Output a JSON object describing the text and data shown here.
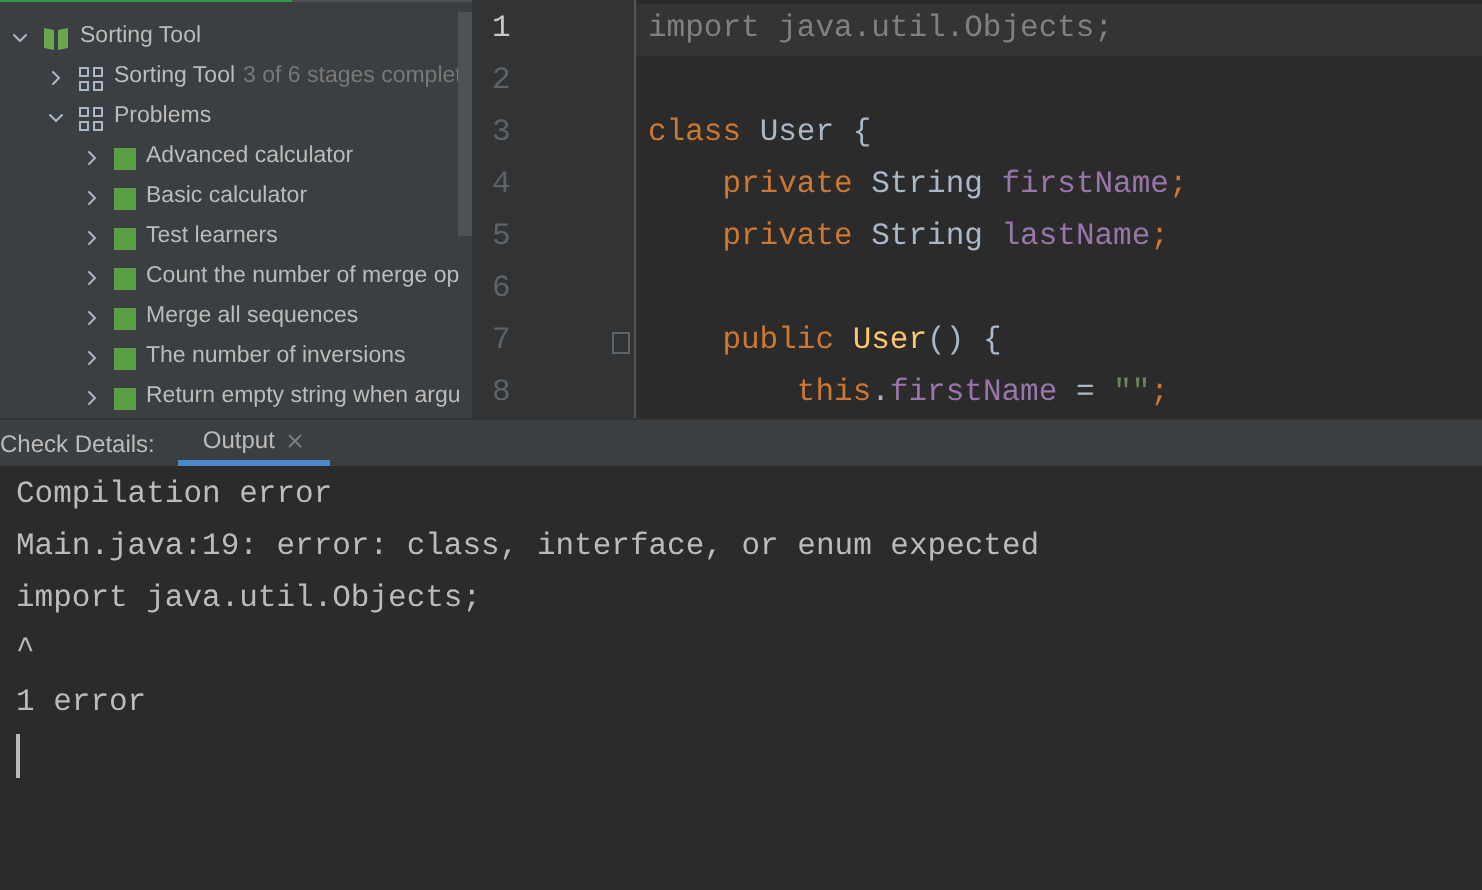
{
  "course_progress": {
    "level": 0.62
  },
  "project_tree": [
    {
      "kind": "course",
      "label": "Sorting Tool",
      "expanded": true,
      "children": [
        {
          "kind": "section",
          "label": "Sorting Tool",
          "note": "3 of 6 stages complet",
          "expanded": false
        },
        {
          "kind": "section",
          "label": "Problems",
          "expanded": true,
          "children": [
            {
              "kind": "task",
              "label": "Advanced calculator",
              "expanded": false
            },
            {
              "kind": "task",
              "label": "Basic calculator",
              "expanded": false
            },
            {
              "kind": "task",
              "label": "Test learners",
              "expanded": false
            },
            {
              "kind": "task",
              "label": "Count the number of merge op",
              "expanded": false
            },
            {
              "kind": "task",
              "label": "Merge all sequences",
              "expanded": false
            },
            {
              "kind": "task",
              "label": "The number of inversions",
              "expanded": false
            },
            {
              "kind": "task",
              "label": "Return empty string when argu",
              "expanded": false
            }
          ]
        }
      ]
    }
  ],
  "editor": {
    "lines": [
      {
        "number": "1",
        "current": true,
        "tokens": [
          {
            "kind": "unused",
            "text": "import java.util.Objects;"
          }
        ]
      },
      {
        "number": "2",
        "current": false
      },
      {
        "number": "3",
        "current": false,
        "tokens": [
          {
            "kind": "keyword",
            "text": "class "
          },
          {
            "kind": "plain",
            "text": "User {"
          }
        ]
      },
      {
        "number": "4",
        "current": false,
        "tokens": [
          {
            "kind": "keyword",
            "text": "    private "
          },
          {
            "kind": "plain",
            "text": "String "
          },
          {
            "kind": "field",
            "text": "firstName"
          },
          {
            "kind": "keyword",
            "text": ";"
          }
        ]
      },
      {
        "number": "5",
        "current": false,
        "tokens": [
          {
            "kind": "keyword",
            "text": "    private "
          },
          {
            "kind": "plain",
            "text": "String "
          },
          {
            "kind": "field",
            "text": "lastName"
          },
          {
            "kind": "keyword",
            "text": ";"
          }
        ]
      },
      {
        "number": "6",
        "current": false
      },
      {
        "number": "7",
        "current": false,
        "fold": true,
        "tokens": [
          {
            "kind": "keyword",
            "text": "    public "
          },
          {
            "kind": "method",
            "text": "User"
          },
          {
            "kind": "plain",
            "text": "() {"
          }
        ]
      },
      {
        "number": "8",
        "current": false,
        "tokens": [
          {
            "kind": "keyword",
            "text": "        this"
          },
          {
            "kind": "plain",
            "text": "."
          },
          {
            "kind": "field",
            "text": "firstName"
          },
          {
            "kind": "plain",
            "text": " = "
          },
          {
            "kind": "string",
            "text": "\"\""
          },
          {
            "kind": "keyword",
            "text": ";"
          }
        ]
      }
    ]
  },
  "bottom_panel": {
    "label": "Check Details:",
    "tabs": [
      {
        "label": "Output",
        "selected": true
      }
    ],
    "output_lines": [
      "Compilation error",
      "Main.java:19: error: class, interface, or enum expected",
      "import java.util.Objects;",
      "^",
      "1 error"
    ]
  }
}
